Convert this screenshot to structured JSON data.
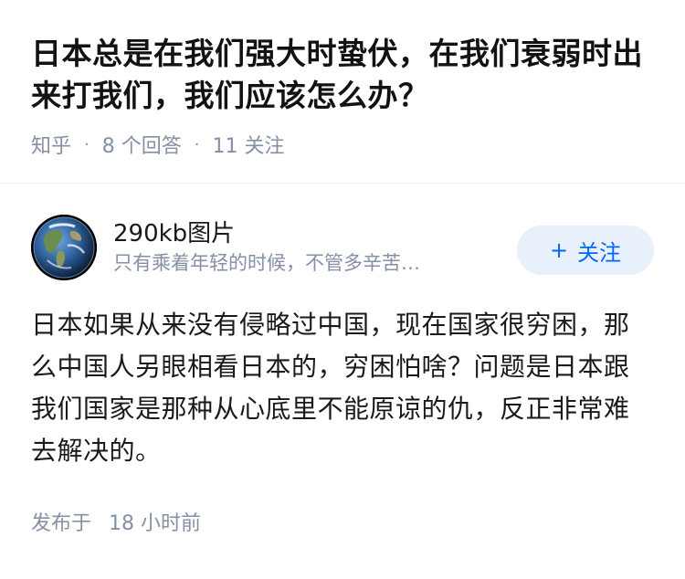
{
  "question": {
    "title": "日本总是在我们强大时蛰伏，在我们衰弱时出来打我们，我们应该怎么办？",
    "source": "知乎",
    "answers_count": "8 个回答",
    "followers_count": "11 关注"
  },
  "answer": {
    "author": {
      "name": "290kb图片",
      "bio": "只有乘着年轻的时候，不管多辛苦…",
      "avatar_icon": "earth-icon"
    },
    "follow_button": {
      "plus": "+",
      "label": "关注"
    },
    "content": "日本如果从来没有侵略过中国，现在国家很穷困，那么中国人另眼相看日本的，穷困怕啥？问题是日本跟我们国家是那种从心底里不能原谅的仇，反正非常难去解决的。",
    "published_label": "发布于",
    "published_time": "18 小时前"
  },
  "colors": {
    "accent": "#0066ff",
    "follow_bg": "#e8f1fb",
    "meta": "#8590a6"
  }
}
